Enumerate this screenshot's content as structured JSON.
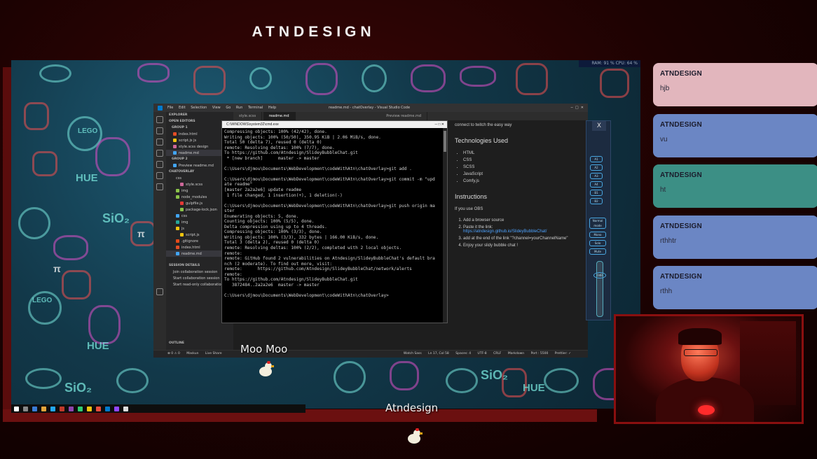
{
  "stream": {
    "channel_title": "ATNDESIGN",
    "system_tray": "RAM: 91 %  CPU: 64 %"
  },
  "desktop": {
    "wallpaper_words": [
      "HUE",
      "LEGO",
      "SiO₂",
      "LEGO",
      "HUE",
      "SiO₂",
      "HUE",
      "SiO₂",
      "π",
      "π"
    ]
  },
  "vscode": {
    "menu": [
      "File",
      "Edit",
      "Selection",
      "View",
      "Go",
      "Run",
      "Terminal",
      "Help"
    ],
    "window_title": "readme.md - chatOverlay - Visual Studio Code",
    "tabs": [
      "style.scss",
      "readme.md",
      "Preview readme.md"
    ],
    "sidebar": {
      "explorer_label": "EXPLORER",
      "open_editors_label": "OPEN EDITORS",
      "group1_label": "GROUP 1",
      "group1_files": [
        "index.html",
        "script.js  js",
        "style.scss  design",
        "readme.md"
      ],
      "group2_label": "GROUP 2",
      "group2_files": [
        "Preview readme.md"
      ],
      "project_label": "CHATOVERLAY",
      "tree": [
        "css",
        "style.scss",
        "img",
        "node_modules",
        "gulpfile.js",
        "package-lock.json",
        "css",
        "img",
        "js",
        "script.js",
        ".gitignore",
        "index.html",
        "readme.md"
      ],
      "session_label": "SESSION DETAILS",
      "session_items": [
        "Join collaboration session",
        "Start collaboration session",
        "Start read-only collaboration"
      ],
      "outline_label": "OUTLINE"
    },
    "preview": {
      "intro": "connect to twitch the easy way",
      "tech_heading": "Technologies Used",
      "tech_list": [
        "HTML",
        "CSS",
        "SCSS",
        "JavaScript",
        "Comfy.js"
      ],
      "instructions_heading": "Instructions",
      "obs_line": "If you use OBS",
      "steps": [
        "Add a browser source",
        "Paste it the link:",
        "https://atndesign.github.io/SlideyBubbleChat/",
        "add at the end of the link \"?channel=yourChannelName\"",
        "Enjoy your slidy bubble chat !"
      ]
    },
    "status": {
      "left": [
        "⊗ 0 ⚠ 0",
        "Maskun",
        "Live Share"
      ],
      "right": [
        "Watch Sass",
        "Ln 17, Col 58",
        "Spaces: 4",
        "UTF-8",
        "CRLF",
        "Markdown",
        "Port : 5500",
        "Prettier: ✓"
      ]
    }
  },
  "terminal": {
    "title": "C:\\WINDOWS\\system32\\cmd.exe",
    "lines": [
      "Compressing objects: 100% (42/42), done.",
      "Writing objects: 100% (50/50), 350.95 KiB | 2.06 MiB/s, done.",
      "Total 50 (delta 7), reused 0 (delta 0)",
      "remote: Resolving deltas: 100% (7/7), done.",
      "To https://github.com/Atndesign/SlideyBubbleChat.git",
      " * [new branch]      master -> master",
      "",
      "C:\\Users\\djmou\\Documents\\WebDevelopment\\codeWithAtn\\chatOverlay>git add .",
      "",
      "C:\\Users\\djmou\\Documents\\WebDevelopment\\codeWithAtn\\chatOverlay>git commit -m \"upd",
      "ate readme\"",
      "[master 2a2a2e6] update readme",
      " 1 file changed, 1 insertion(+), 1 deletion(-)",
      "",
      "C:\\Users\\djmou\\Documents\\WebDevelopment\\codeWithAtn\\chatOverlay>git push origin ma",
      "ster",
      "Enumerating objects: 5, done.",
      "Counting objects: 100% (5/5), done.",
      "Delta compression using up to 4 threads.",
      "Compressing objects: 100% (3/3), done.",
      "Writing objects: 100% (3/3), 332 bytes | 166.00 KiB/s, done.",
      "Total 3 (delta 2), reused 0 (delta 0)",
      "remote: Resolving deltas: 100% (2/2), completed with 2 local objects.",
      "remote:",
      "remote: GitHub found 2 vulnerabilities on Atndesign/SlideyBubbleChat's default bra",
      "nch (2 moderate). To find out more, visit:",
      "remote:      https://github.com/Atndesign/SlideyBubbleChat/network/alerts",
      "remote:",
      "To https://github.com/Atndesign/SlideyBubbleChat.git",
      "   3872484..2a2a2e6  master -> master",
      "",
      "C:\\Users\\djmou\\Documents\\WebDevelopment\\codeWithAtn\\chatOverlay>"
    ]
  },
  "mixer": {
    "close_label": "X",
    "channels": [
      "A1",
      "A2",
      "A3",
      "A4",
      "B1",
      "B2"
    ],
    "buttons": [
      "Normal mode",
      "Mono",
      "Solo",
      "Mute"
    ],
    "db": "0dB"
  },
  "chat": [
    {
      "name": "ATNDESIGN",
      "message": "hjb",
      "color": "#e2b6bd"
    },
    {
      "name": "ATNDESIGN",
      "message": "vu",
      "color": "#6b86c4"
    },
    {
      "name": "ATNDESIGN",
      "message": "ht",
      "color": "#3c8f85"
    },
    {
      "name": "ATNDESIGN",
      "message": "rthhtr",
      "color": "#6b86c4"
    },
    {
      "name": "ATNDESIGN",
      "message": "rthh",
      "color": "#6b86c4"
    }
  ],
  "avatars": [
    {
      "label": "Moo Moo"
    },
    {
      "label": "Atndesign"
    }
  ]
}
